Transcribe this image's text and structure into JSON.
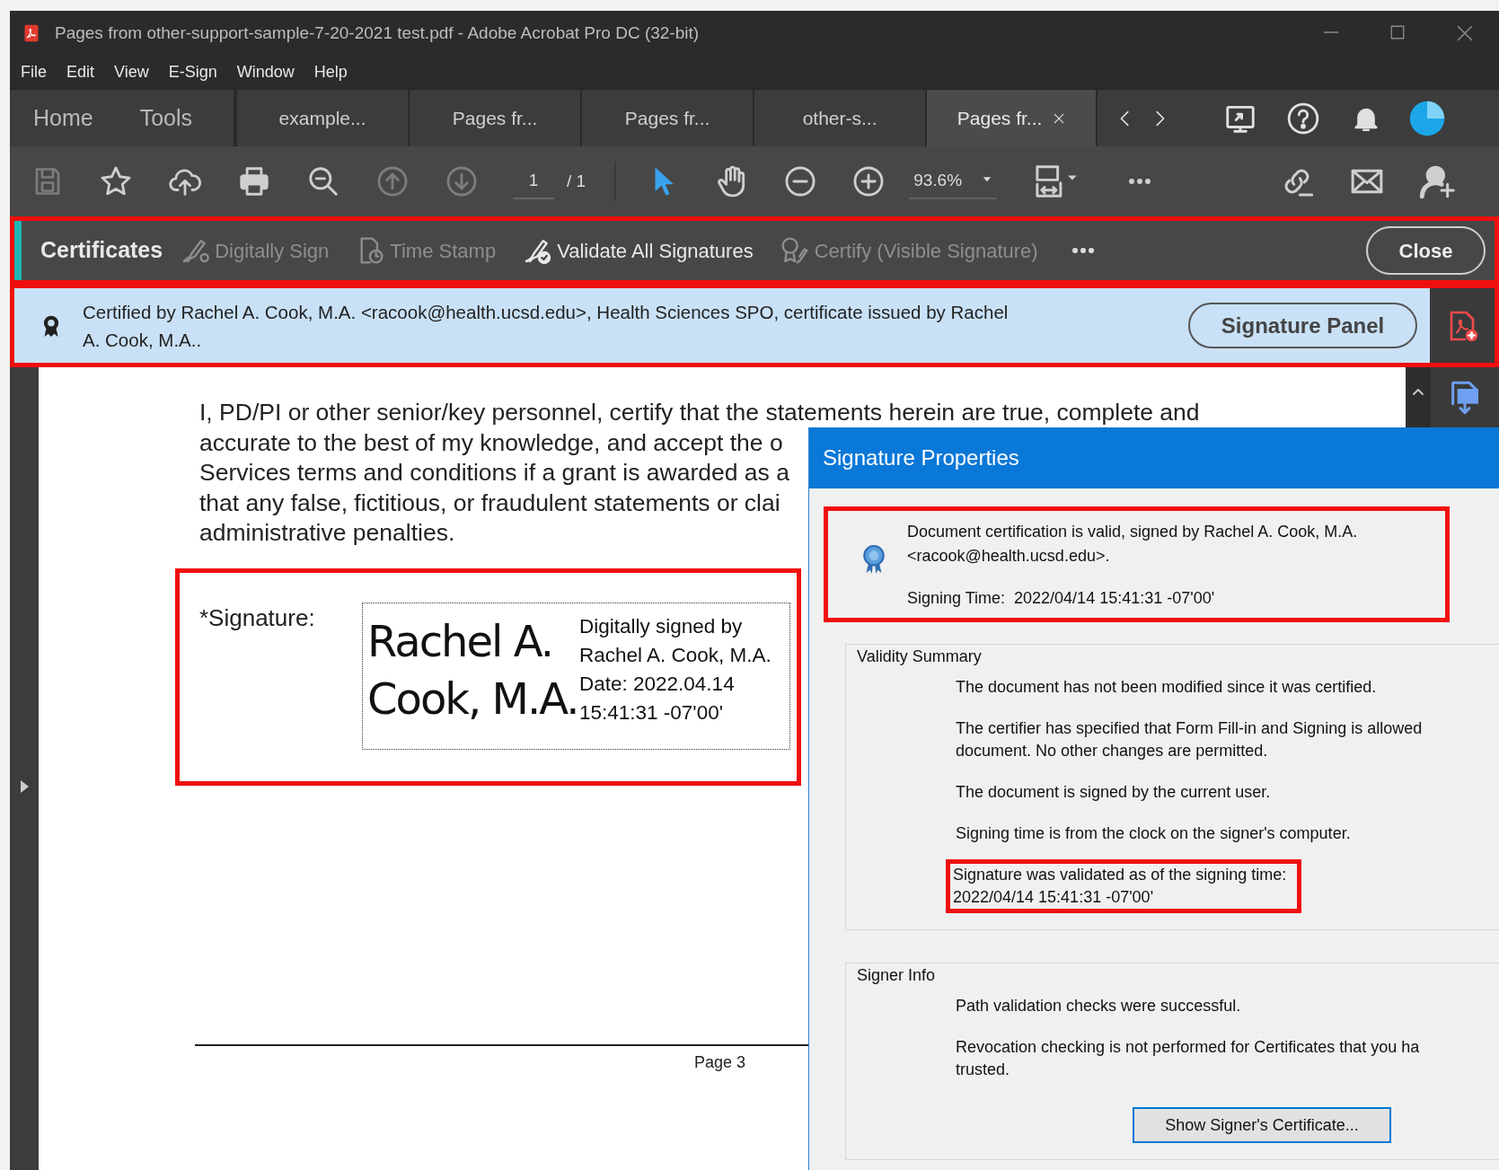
{
  "window": {
    "title": "Pages from other-support-sample-7-20-2021 test.pdf - Adobe Acrobat Pro DC (32-bit)"
  },
  "menu": [
    "File",
    "Edit",
    "View",
    "E-Sign",
    "Window",
    "Help"
  ],
  "nav": [
    "Home",
    "Tools"
  ],
  "tabs": [
    {
      "label": "example...",
      "selected": false
    },
    {
      "label": "Pages fr...",
      "selected": false
    },
    {
      "label": "Pages fr...",
      "selected": false
    },
    {
      "label": "other-s...",
      "selected": false
    },
    {
      "label": "Pages fr...",
      "selected": true
    }
  ],
  "toolbar": {
    "page": "1",
    "page_total": "/ 1",
    "zoom": "93.6%"
  },
  "tool_panel": {
    "title": "Certificates",
    "highlighted": true,
    "close": "Close",
    "tools": [
      {
        "label": "Digitally Sign",
        "disabled": true
      },
      {
        "label": "Time Stamp",
        "disabled": true
      },
      {
        "label": "Validate All Signatures",
        "disabled": false
      },
      {
        "label": "Certify (Visible Signature)",
        "disabled": true
      }
    ]
  },
  "banner": {
    "text": "Certified by Rachel A. Cook, M.A. <racook@health.ucsd.edu>, Health Sciences SPO, certificate issued by Rachel A. Cook, M.A..",
    "button": "Signature Panel",
    "highlighted": true
  },
  "document": {
    "lines": [
      "I, PD/PI or other senior/key personnel, certify that the statements herein are true, complete and",
      "accurate to the best of my knowledge, and accept the o",
      "Services terms and conditions if a grant is awarded as a",
      "that any false, fictitious, or fraudulent statements or clai",
      "administrative penalties."
    ],
    "signature": {
      "highlighted": true,
      "label": "*Signature:",
      "name": [
        "Rachel A.",
        "Cook, M.A."
      ],
      "details": [
        "Digitally signed by",
        "Rachel A. Cook, M.A.",
        "Date: 2022.04.14",
        "15:41:31 -07'00'"
      ]
    },
    "footer": "Page 3"
  },
  "dialog": {
    "title": "Signature Properties",
    "status": {
      "highlighted": true,
      "text": "Document certification is valid, signed by Rachel A. Cook, M.A. <racook@health.ucsd.edu>.",
      "signing_time_label": "Signing Time:",
      "signing_time": "2022/04/14 15:41:31 -07'00'"
    },
    "validity": {
      "title": "Validity Summary",
      "items": [
        {
          "lines": [
            "The document has not been modified since it was certified."
          ],
          "highlighted": false
        },
        {
          "lines": [
            "The certifier has specified that Form Fill-in and Signing is allowed",
            "document. No other changes are permitted."
          ],
          "highlighted": false
        },
        {
          "lines": [
            "The document is signed by the current user."
          ],
          "highlighted": false
        },
        {
          "lines": [
            "Signing time is from the clock on the signer's computer."
          ],
          "highlighted": false
        },
        {
          "lines": [
            "Signature was validated as of the signing time:",
            "2022/04/14 15:41:31 -07'00'"
          ],
          "highlighted": true
        }
      ]
    },
    "signer": {
      "title": "Signer Info",
      "items": [
        {
          "lines": [
            "Path validation checks were successful."
          ]
        },
        {
          "lines": [
            "Revocation checking is not performed for Certificates that you ha",
            "trusted."
          ]
        }
      ],
      "button": "Show Signer's Certificate..."
    }
  }
}
